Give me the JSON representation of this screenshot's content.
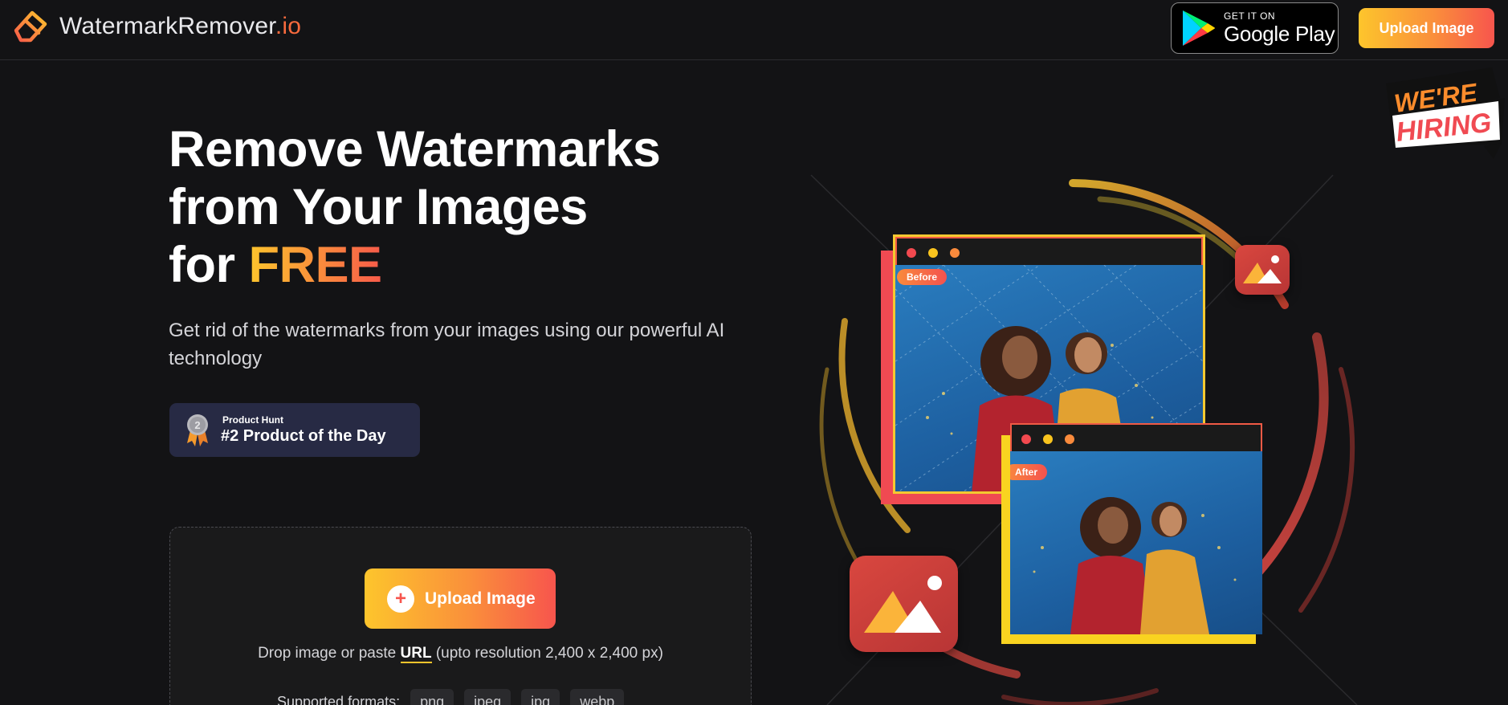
{
  "header": {
    "logo_text": "WatermarkRemover",
    "logo_suffix": ".io",
    "google_play": {
      "small": "GET IT ON",
      "big": "Google Play"
    },
    "upload_label": "Upload Image"
  },
  "hiring_badge": {
    "line1": "WE'RE",
    "line2": "HIRING"
  },
  "hero": {
    "title_line1": "Remove Watermarks",
    "title_line2": "from Your Images",
    "title_line3_prefix": "for ",
    "title_highlight": "FREE",
    "subtitle": "Get rid of the watermarks from your images using our powerful AI technology"
  },
  "product_hunt": {
    "rank": "2",
    "label": "Product Hunt",
    "title": "#2 Product of the Day"
  },
  "dropzone": {
    "button_label": "Upload Image",
    "drop_prefix": "Drop image or paste ",
    "drop_link": "URL",
    "drop_suffix": " (upto resolution 2,400 x 2,400 px)",
    "formats_label": "Supported formats:",
    "formats": [
      "png",
      "jpeg",
      "jpg",
      "webp"
    ]
  },
  "illustration": {
    "before_label": "Before",
    "after_label": "After"
  },
  "colors": {
    "accent_yellow": "#fdc52c",
    "accent_orange": "#fa8f3b",
    "accent_red": "#f7554d",
    "background": "#131315"
  }
}
